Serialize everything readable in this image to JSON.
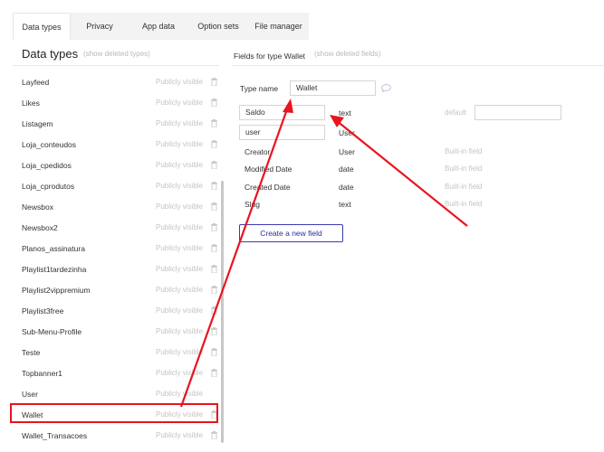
{
  "tabs": [
    "Data types",
    "Privacy",
    "App data",
    "Option sets",
    "File manager"
  ],
  "left": {
    "title": "Data types",
    "show_deleted": "(show deleted types)",
    "types": [
      {
        "name": "Layfeed",
        "visibility": "Publicly visible"
      },
      {
        "name": "Likes",
        "visibility": "Publicly visible"
      },
      {
        "name": "Listagem",
        "visibility": "Publicly visible"
      },
      {
        "name": "Loja_conteudos",
        "visibility": "Publicly visible"
      },
      {
        "name": "Loja_cpedidos",
        "visibility": "Publicly visible"
      },
      {
        "name": "Loja_cprodutos",
        "visibility": "Publicly visible"
      },
      {
        "name": "Newsbox",
        "visibility": "Publicly visible"
      },
      {
        "name": "Newsbox2",
        "visibility": "Publicly visible"
      },
      {
        "name": "Planos_assinatura",
        "visibility": "Publicly visible"
      },
      {
        "name": "Playlist1tardezinha",
        "visibility": "Publicly visible"
      },
      {
        "name": "Playlist2vippremium",
        "visibility": "Publicly visible"
      },
      {
        "name": "Playlist3free",
        "visibility": "Publicly visible"
      },
      {
        "name": "Sub-Menu-Profile",
        "visibility": "Publicly visible"
      },
      {
        "name": "Teste",
        "visibility": "Publicly visible"
      },
      {
        "name": "Topbanner1",
        "visibility": "Publicly visible"
      },
      {
        "name": "User",
        "visibility": "Publicly visible"
      },
      {
        "name": "Wallet",
        "visibility": "Publicly visible"
      },
      {
        "name": "Wallet_Transacoes",
        "visibility": "Publicly visible"
      }
    ]
  },
  "right": {
    "title": "Fields for type Wallet",
    "show_deleted": "(show deleted fields)",
    "type_name_label": "Type name",
    "type_name_value": "Wallet",
    "fields": [
      {
        "name": "Saldo",
        "type": "text",
        "default_label": "default"
      },
      {
        "name": "user",
        "type": "User"
      }
    ],
    "builtin_fields": [
      {
        "name": "Creator",
        "type": "User",
        "note": "Built-in field"
      },
      {
        "name": "Modified Date",
        "type": "date",
        "note": "Built-in field"
      },
      {
        "name": "Created Date",
        "type": "date",
        "note": "Built-in field"
      },
      {
        "name": "Slug",
        "type": "text",
        "note": "Built-in field"
      }
    ],
    "create_button": "Create a new field"
  },
  "annotation_color": "#e8141e"
}
